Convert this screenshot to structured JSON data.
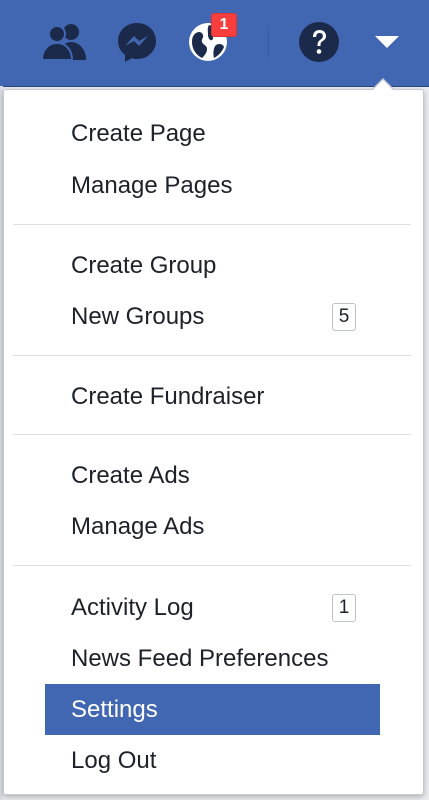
{
  "topbar": {
    "icons": [
      "friends-icon",
      "messenger-icon",
      "globe-icon",
      "help-icon",
      "menu-caret-icon"
    ],
    "notification_count": "1",
    "colors": {
      "bar": "#4267b2",
      "icon": "#1b2a4a",
      "badge": "#fa3e3e"
    }
  },
  "menu": {
    "items": [
      {
        "label": "Create Page"
      },
      {
        "label": "Manage Pages"
      },
      {
        "label": "Create Group"
      },
      {
        "label": "New Groups",
        "badge": "5"
      },
      {
        "label": "Create Fundraiser"
      },
      {
        "label": "Create Ads"
      },
      {
        "label": "Manage Ads"
      },
      {
        "label": "Activity Log",
        "badge": "1"
      },
      {
        "label": "News Feed Preferences"
      },
      {
        "label": "Settings"
      },
      {
        "label": "Log Out"
      }
    ],
    "active_color": "#4267b2"
  }
}
